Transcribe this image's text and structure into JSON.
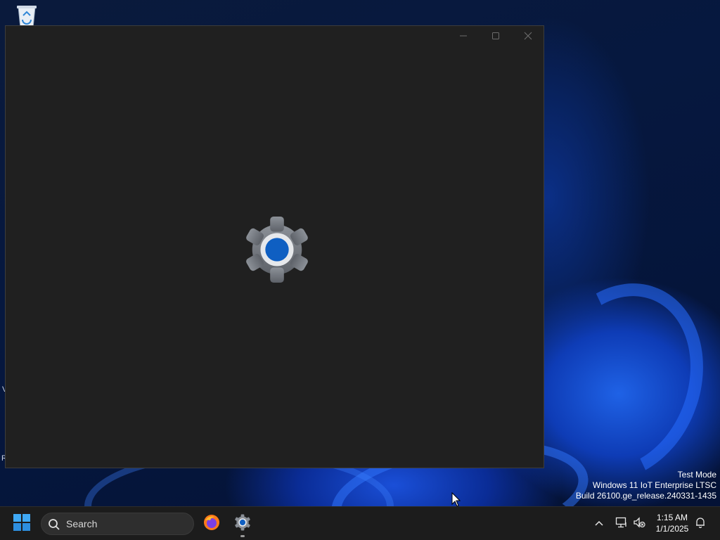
{
  "desktop": {
    "recycle_bin_icon": "recycle-bin-icon",
    "edge_fragments": [
      "V",
      "R"
    ],
    "watermark": {
      "line1": "Test Mode",
      "line2": "Windows 11 IoT Enterprise LTSC",
      "line3": "Build 26100.ge_release.240331-1435"
    }
  },
  "window": {
    "title": "",
    "splash_icon": "settings-gear-icon",
    "controls": {
      "minimize_icon": "minimize-icon",
      "maximize_icon": "maximize-icon",
      "close_icon": "close-icon"
    },
    "background_color": "#202020"
  },
  "taskbar": {
    "start_icon": "windows-start-icon",
    "search": {
      "label": "Search",
      "icon": "search-icon"
    },
    "apps": [
      {
        "name": "Firefox",
        "icon": "firefox-icon",
        "running": false
      },
      {
        "name": "Settings",
        "icon": "settings-gear-icon",
        "running": true
      }
    ],
    "tray": {
      "overflow_icon": "chevron-up-icon",
      "network_icon": "network-monitor-icon",
      "volume_icon": "speaker-muted-icon",
      "notification_icon": "bell-icon"
    },
    "clock": {
      "time": "1:15 AM",
      "date": "1/1/2025"
    }
  },
  "colors": {
    "accent_blue": "#0f5fc2",
    "taskbar_bg": "#1c1c1c",
    "window_bg": "#202020"
  }
}
